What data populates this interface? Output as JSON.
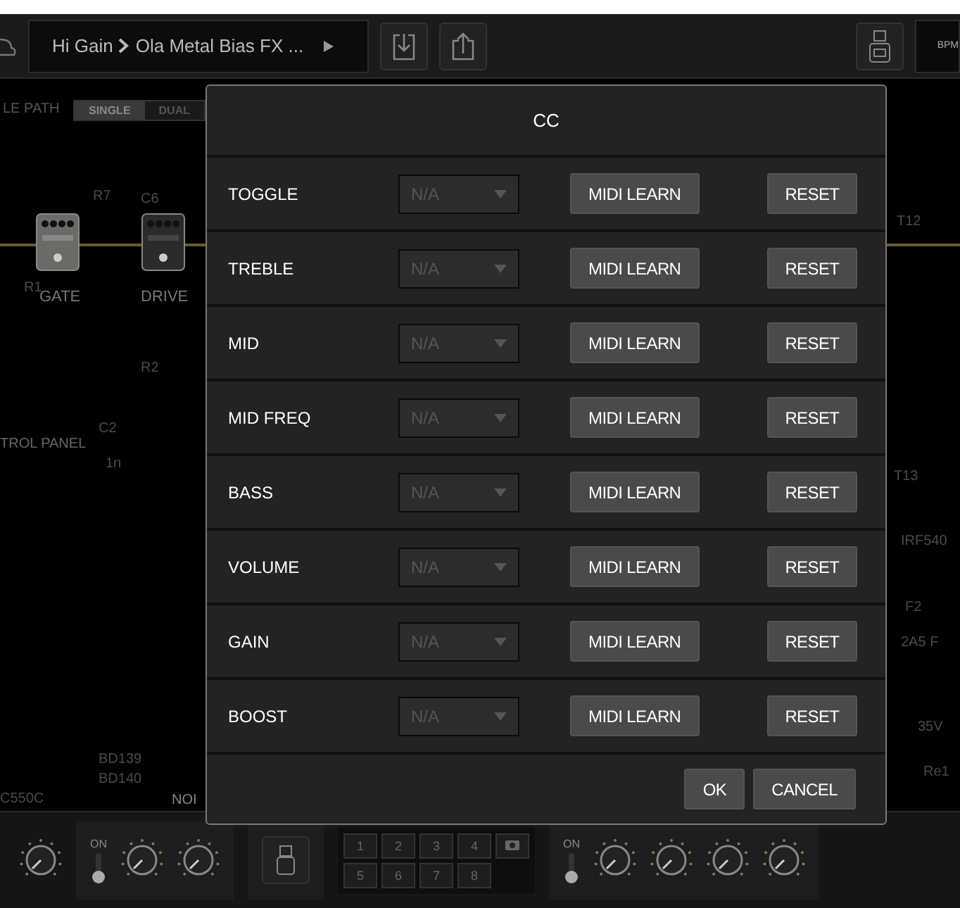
{
  "toolbar": {
    "bank": "Hi Gain",
    "preset": "Ola Metal Bias FX ...",
    "bpm": "BPM"
  },
  "signal_path": {
    "label": "LE PATH",
    "options": [
      {
        "label": "SINGLE",
        "selected": true
      },
      {
        "label": "DUAL",
        "selected": false
      }
    ]
  },
  "pedals": [
    {
      "label": "GATE",
      "kind": "gate"
    },
    {
      "label": "DRIVE",
      "kind": "drive"
    }
  ],
  "section_label": "TROL PANEL",
  "schematic_labels": [
    "R7",
    "C6",
    "T12",
    "R1",
    "R2",
    "C2",
    "1n",
    "T13",
    "IRF540",
    "F2",
    "2A5 F",
    "35V",
    "BD139",
    "Re1",
    "BD140",
    "C550C"
  ],
  "bottom_panel": {
    "section": "NOI",
    "switches": [
      {
        "label": "ON"
      },
      {
        "label": "ON"
      }
    ],
    "quick_snap": [
      "1",
      "2",
      "3",
      "4",
      "5",
      "6",
      "7",
      "8"
    ]
  },
  "dialog": {
    "title": "CC",
    "rows": [
      {
        "label": "TOGGLE",
        "value": "N/A",
        "disabled": true,
        "learn": "MIDI LEARN",
        "reset": "RESET"
      },
      {
        "label": "TREBLE",
        "value": "N/A",
        "disabled": true,
        "learn": "MIDI LEARN",
        "reset": "RESET"
      },
      {
        "label": "MID",
        "value": "N/A",
        "disabled": true,
        "learn": "MIDI LEARN",
        "reset": "RESET"
      },
      {
        "label": "MID FREQ",
        "value": "N/A",
        "disabled": true,
        "learn": "MIDI LEARN",
        "reset": "RESET"
      },
      {
        "label": "BASS",
        "value": "N/A",
        "disabled": true,
        "learn": "MIDI LEARN",
        "reset": "RESET"
      },
      {
        "label": "VOLUME",
        "value": "N/A",
        "disabled": true,
        "learn": "MIDI LEARN",
        "reset": "RESET"
      },
      {
        "label": "GAIN",
        "value": "N/A",
        "disabled": true,
        "learn": "MIDI LEARN",
        "reset": "RESET"
      },
      {
        "label": "BOOST",
        "value": "N/A",
        "disabled": true,
        "learn": "MIDI LEARN",
        "reset": "RESET"
      }
    ],
    "ok": "OK",
    "cancel": "CANCEL"
  }
}
